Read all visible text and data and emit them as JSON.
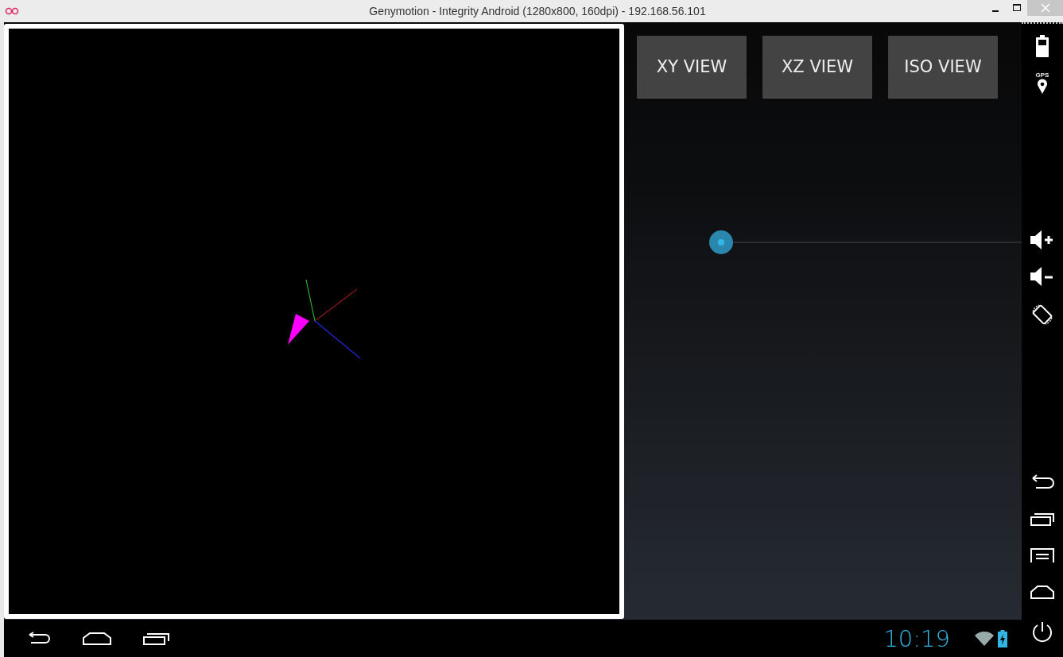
{
  "window": {
    "title": "Genymotion - Integrity Android (1280x800, 160dpi) - 192.168.56.101"
  },
  "view_buttons": [
    {
      "label": "XY VIEW"
    },
    {
      "label": "XZ VIEW"
    },
    {
      "label": "ISO VIEW"
    }
  ],
  "slider": {
    "level": 0
  },
  "status_bar": {
    "time": "10:19"
  },
  "sidebar": {
    "gps_label": "GPS"
  }
}
